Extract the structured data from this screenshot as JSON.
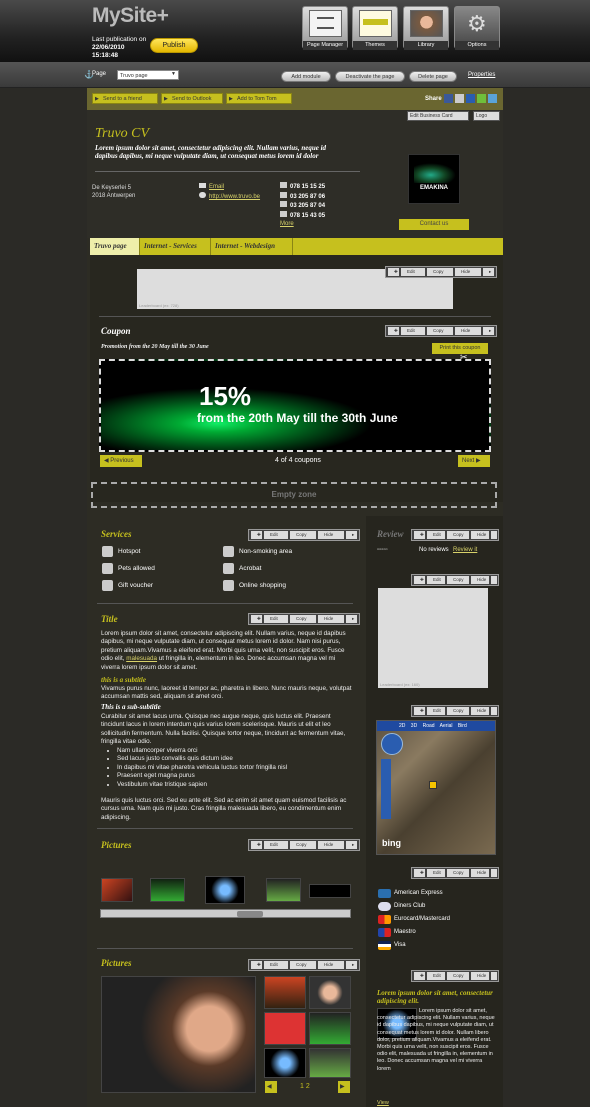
{
  "topbar": {
    "logo": "MySite+",
    "last_pub_label": "Last publication on",
    "last_pub_date": "22/06/2010",
    "last_pub_time": "15:18:48",
    "publish_label": "Publish",
    "tools": [
      "Page Manager",
      "Themes",
      "Library",
      "Options"
    ]
  },
  "subbar": {
    "page_label": "Page",
    "page_value": "Truvo page",
    "buttons": [
      "Add module",
      "Deactivate the page",
      "Delete page"
    ],
    "properties": "Properties"
  },
  "toolbar": {
    "send_friend": "Send to a friend",
    "send_outlook": "Send to Outlook",
    "add_tomtom": "Add to Tom Tom",
    "share": "Share"
  },
  "cv": {
    "edit_card": "Edit Business Card",
    "logo_btn": "Logo",
    "title": "Truvo CV",
    "description": "Lorem ipsum dolor sit amet, consectetur adipiscing elit. Nullam varius, neque id dapibus dapibus, mi neque vulputate diam, ut consequat metus lorem id dolor",
    "street": "De Keyserlei 5",
    "city": "2018 Antwerpen",
    "email": "Email",
    "website": "http://www.truvo.be",
    "phones": [
      "078 15 15 25",
      "03 205 87 06",
      "03 205 87 04",
      "078 15 43 05"
    ],
    "more": "More",
    "logo_text": "EMAKINA",
    "contact": "Contact us"
  },
  "tabs": [
    "Truvo page",
    "Internet - Services",
    "Internet - Webdesign"
  ],
  "widget_bar": {
    "edit": "Edit",
    "copy": "Copy",
    "hide": "Hide"
  },
  "leaderboard": "Leaderboard (ex: 728)",
  "coupon": {
    "title": "Coupon",
    "promo": "Promotion from the 20 May till the 30 June",
    "print": "Print this coupon",
    "percent": "15%",
    "dates": "from the 20th May till the 30th June",
    "previous": "Previous",
    "counter": "4 of 4 coupons",
    "next": "Next"
  },
  "empty_zone": "Empty zone",
  "services": {
    "title": "Services",
    "items": [
      "Hotspot",
      "Non-smoking area",
      "Pets allowed",
      "Acrobat",
      "Gift voucher",
      "Online shopping"
    ]
  },
  "text_block": {
    "title": "Title",
    "p1a": "Lorem ipsum dolor sit amet, consectetur adipiscing elit. Nullam varius, neque id dapibus dapibus, mi neque vulputate diam, ut consequat metus lorem id dolor. Nam nisi purus, pretium aliquam.Vivamus a eleifend erat. Morbi quis urna velit, non suscipit eros. Fusce odio elit, ",
    "p1link": "malesuada",
    "p1b": " ut fringilla in, elementum in leo. Donec accumsan magna vel mi viverra lorem ipsum dolor sit amet.",
    "subtitle": "this is a subtitle",
    "p2": "Vivamus purus nunc, laoreet id tempor ac, pharetra in libero. Nunc mauris neque, volutpat accumsan mattis sed, aliquam sit amet orci.",
    "subsub": "This is a sub-subtitle",
    "p3": "Curabitur sit amet lacus urna. Quisque nec augue neque, quis luctus elit. Praesent tincidunt lacus in lorem interdum quis varius lorem scelerisque. Mauris ut elit et leo sollicitudin fermentum. Nulla facilisi. Quisque tortor neque, tincidunt ac fermentum vitae, fringilla vitae odio.",
    "bullets": [
      "Nam ullamcorper viverra orci",
      "Sed lacus justo convallis quis dictum idee",
      "In dapibus mi vitae pharetra vehicula luctus tortor fringilla nisl",
      "Praesent eget magna purus",
      "Vestibulum vitae tristique sapien"
    ],
    "p4": "Mauris quis luctus orci. Sed eu ante elit. Sed ac enim sit amet quam euismod facilisis ac cursus urna. Nam quis mi justo. Cras fringilla malesuada libero, eu condimentum enim adipiscing."
  },
  "pictures": {
    "title": "Pictures",
    "title2": "Pictures",
    "pager": "1 2"
  },
  "review": {
    "title": "Review",
    "none": "No reviews",
    "link": "Review it"
  },
  "skyscraper": "Leaderboard (ex: 160)",
  "map": {
    "views": [
      "2D",
      "3D",
      "Road",
      "Aerial",
      "Bird"
    ],
    "brand": "bing"
  },
  "payment": {
    "items": [
      "American Express",
      "Diners Club",
      "Eurocard/Mastercard",
      "Maestro",
      "Visa"
    ]
  },
  "right_text": {
    "title": "Lorem ipsum dolor sit amet, consectetur adipiscing elit.",
    "body": "Lorem ipsum dolor sit amet, consectetur adipiscing elit. Nullam varius, neque id dapibus dapibus, mi neque vulputate diam, ut consequat metus lorem id dolor. Nullam libero dolor, pretium aliquam.Vivamus a eleifend erat. Morbi quis urna velit, non suscipit eros. Fusce odio elit, malesuada ut fringilla in, elementum in leo. Donec accumsan magna vel mi viverra lorem",
    "view": "View"
  }
}
